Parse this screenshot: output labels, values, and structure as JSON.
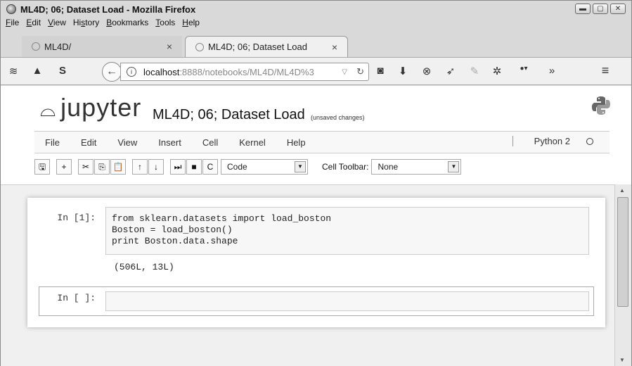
{
  "window": {
    "title": "ML4D; 06; Dataset Load - Mozilla Firefox",
    "controls": [
      "minimize",
      "maximize",
      "close"
    ]
  },
  "menubar": {
    "items": [
      {
        "pre": "",
        "u": "F",
        "post": "ile"
      },
      {
        "pre": "",
        "u": "E",
        "post": "dit"
      },
      {
        "pre": "",
        "u": "V",
        "post": "iew"
      },
      {
        "pre": "Hi",
        "u": "s",
        "post": "tory"
      },
      {
        "pre": "",
        "u": "B",
        "post": "ookmarks"
      },
      {
        "pre": "",
        "u": "T",
        "post": "ools"
      },
      {
        "pre": "",
        "u": "H",
        "post": "elp"
      }
    ]
  },
  "tabs": [
    {
      "label": "ML4D/",
      "close": "×"
    },
    {
      "label": "ML4D; 06; Dataset Load",
      "close": "×"
    }
  ],
  "navbar": {
    "url_host": "localhost",
    "url_rest": ":8888/notebooks/ML4D/ML4D%3",
    "icons": [
      "rss-icon",
      "bookmarks-icon",
      "s-icon",
      "back-icon",
      "pocket-icon",
      "download-icon",
      "block-icon",
      "send-icon",
      "pen-icon",
      "extension-icon",
      "adblock-icon",
      "overflow-icon",
      "hamburger-menu-icon"
    ]
  },
  "jupyter": {
    "logo_text": "jupyter",
    "notebook_name": "ML4D; 06; Dataset Load",
    "unsaved": "(unsaved changes)",
    "menu": [
      "File",
      "Edit",
      "View",
      "Insert",
      "Cell",
      "Kernel",
      "Help"
    ],
    "kernel": "Python 2",
    "cell_type": "Code",
    "cell_toolbar_label": "Cell Toolbar:",
    "cell_toolbar_value": "None"
  },
  "toolbar": {
    "buttons": [
      {
        "name": "save-icon",
        "glyph": "🖫"
      },
      {
        "name": "insert-cell-icon",
        "glyph": "+"
      },
      {
        "name": "cut-icon",
        "glyph": "✂"
      },
      {
        "name": "copy-icon",
        "glyph": "⎘"
      },
      {
        "name": "paste-icon",
        "glyph": "📋"
      },
      {
        "name": "move-up-icon",
        "glyph": "↑"
      },
      {
        "name": "move-down-icon",
        "glyph": "↓"
      },
      {
        "name": "run-icon",
        "glyph": "⏭"
      },
      {
        "name": "stop-icon",
        "glyph": "■"
      },
      {
        "name": "restart-icon",
        "glyph": "C"
      }
    ]
  },
  "cells": [
    {
      "prompt": "In [1]:",
      "code": "from sklearn.datasets import load_boston\nBoston = load_boston()\nprint Boston.data.shape",
      "output": "(506L, 13L)"
    },
    {
      "prompt": "In [ ]:",
      "code": "",
      "output": ""
    }
  ]
}
